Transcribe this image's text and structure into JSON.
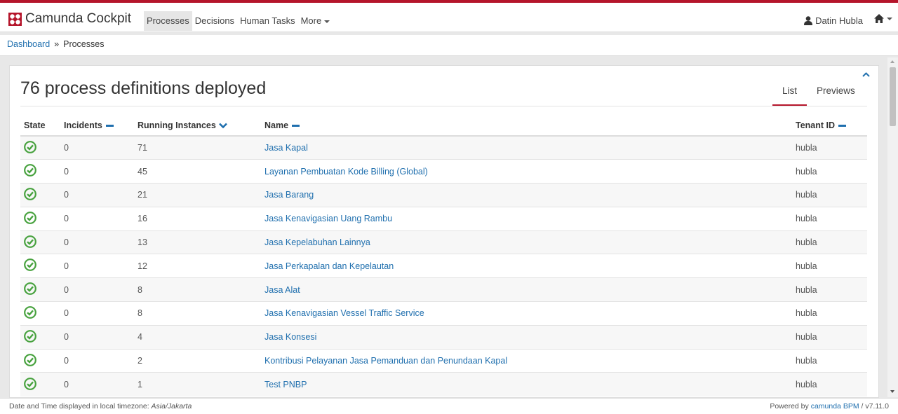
{
  "header": {
    "brand": "Camunda Cockpit",
    "nav": [
      {
        "label": "Processes",
        "active": true
      },
      {
        "label": "Decisions"
      },
      {
        "label": "Human Tasks"
      },
      {
        "label": "More"
      }
    ],
    "user": "Datin Hubla"
  },
  "breadcrumb": {
    "items": [
      "Dashboard",
      "Processes"
    ],
    "separator": "»"
  },
  "panel": {
    "title": "76 process definitions deployed",
    "tabs": [
      {
        "label": "List",
        "active": true
      },
      {
        "label": "Previews"
      }
    ]
  },
  "table": {
    "headers": {
      "state": "State",
      "incidents": "Incidents",
      "running": "Running Instances",
      "name": "Name",
      "tenant": "Tenant ID"
    },
    "rows": [
      {
        "incidents": "0",
        "running": "71",
        "name": "Jasa Kapal",
        "tenant": "hubla"
      },
      {
        "incidents": "0",
        "running": "45",
        "name": "Layanan Pembuatan Kode Billing (Global)",
        "tenant": "hubla"
      },
      {
        "incidents": "0",
        "running": "21",
        "name": "Jasa Barang",
        "tenant": "hubla"
      },
      {
        "incidents": "0",
        "running": "16",
        "name": "Jasa Kenavigasian Uang Rambu",
        "tenant": "hubla"
      },
      {
        "incidents": "0",
        "running": "13",
        "name": "Jasa Kepelabuhan Lainnya",
        "tenant": "hubla"
      },
      {
        "incidents": "0",
        "running": "12",
        "name": "Jasa Perkapalan dan Kepelautan",
        "tenant": "hubla"
      },
      {
        "incidents": "0",
        "running": "8",
        "name": "Jasa Alat",
        "tenant": "hubla"
      },
      {
        "incidents": "0",
        "running": "8",
        "name": "Jasa Kenavigasian Vessel Traffic Service",
        "tenant": "hubla"
      },
      {
        "incidents": "0",
        "running": "4",
        "name": "Jasa Konsesi",
        "tenant": "hubla"
      },
      {
        "incidents": "0",
        "running": "2",
        "name": "Kontribusi Pelayanan Jasa Pemanduan dan Penundaan Kapal",
        "tenant": "hubla"
      },
      {
        "incidents": "0",
        "running": "1",
        "name": "Test PNBP",
        "tenant": "hubla"
      }
    ]
  },
  "footer": {
    "timezone_prefix": "Date and Time displayed in local timezone: ",
    "timezone": "Asia/Jakarta",
    "powered_prefix": "Powered by ",
    "powered_link": "camunda BPM",
    "version": " / v7.11.0"
  },
  "colors": {
    "brand_red": "#b5152b",
    "link_blue": "#1f6fae",
    "state_green": "#48a23f"
  }
}
